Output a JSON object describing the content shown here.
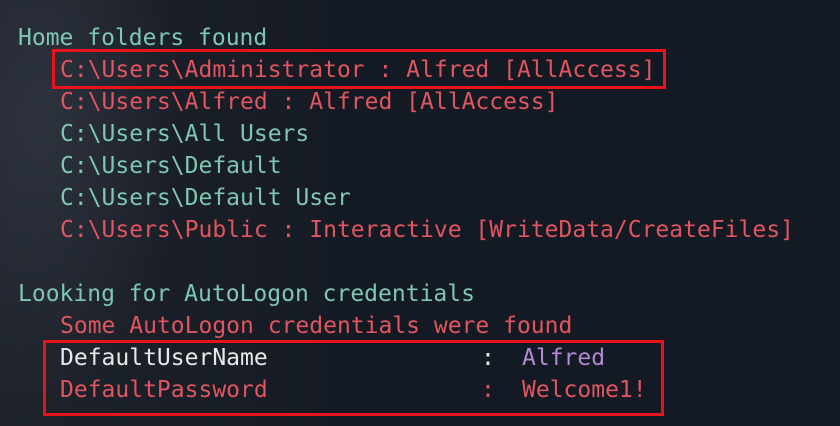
{
  "sections": {
    "home": {
      "heading": "Home folders found",
      "entries": [
        "C:\\Users\\Administrator : Alfred [AllAccess]",
        "C:\\Users\\Alfred : Alfred [AllAccess]",
        "C:\\Users\\All Users",
        "C:\\Users\\Default",
        "C:\\Users\\Default User",
        "C:\\Users\\Public : Interactive [WriteData/CreateFiles]"
      ]
    },
    "autologon": {
      "heading": "Looking for AutoLogon credentials",
      "notice": "Some AutoLogon credentials were found",
      "user_key": "DefaultUserName",
      "user_sep": ":",
      "user_value": "Alfred",
      "pass_key": "DefaultPassword",
      "pass_sep": ":",
      "pass_value": "Welcome1!"
    }
  },
  "colors": {
    "background": "#141a24",
    "heading": "#7ec7b1",
    "alert": "#e0555f",
    "value": "#b389d4",
    "highlight_box": "#e8141c"
  }
}
